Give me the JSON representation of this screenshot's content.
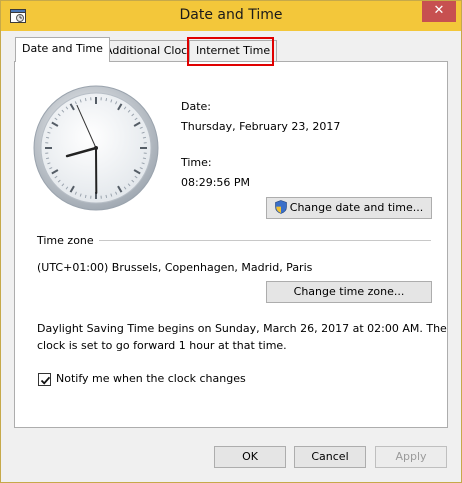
{
  "window": {
    "title": "Date and Time"
  },
  "tabs": [
    {
      "label": "Date and Time",
      "active": true
    },
    {
      "label": "Additional Clocks",
      "active": false
    },
    {
      "label": "Internet Time",
      "active": false,
      "highlighted": true
    }
  ],
  "clock": {
    "hour": 8,
    "minute": 29,
    "second": 56
  },
  "date": {
    "label": "Date:",
    "value": "Thursday, February 23, 2017"
  },
  "time": {
    "label": "Time:",
    "value": "08:29:56 PM"
  },
  "buttons": {
    "change_datetime": "Change date and time...",
    "change_timezone": "Change time zone...",
    "ok": "OK",
    "cancel": "Cancel",
    "apply": "Apply"
  },
  "timezone": {
    "label": "Time zone",
    "value": "(UTC+01:00) Brussels, Copenhagen, Madrid, Paris"
  },
  "dst": {
    "line1": "Daylight Saving Time begins on Sunday, March 26, 2017 at 02:00 AM. The",
    "line2": "clock is set to go forward 1 hour at that time."
  },
  "notify": {
    "label": "Notify me when the clock changes",
    "checked": true
  },
  "icons": {
    "app": "date-time-app-icon",
    "close": "close-icon",
    "shield": "uac-shield-icon",
    "check": "checkmark-icon"
  },
  "colors": {
    "titlebar": "#f3c73a",
    "close": "#c75050",
    "highlight": "#e00000"
  }
}
